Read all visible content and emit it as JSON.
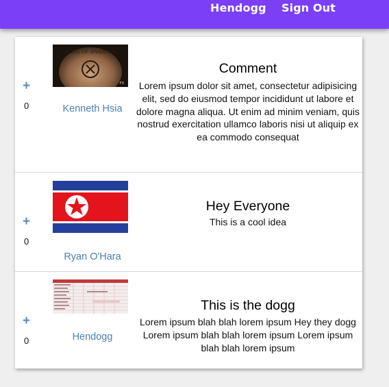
{
  "nav": {
    "user": "Hendogg",
    "sign_out": "Sign Out"
  },
  "posts": [
    {
      "votes": "0",
      "plus": "+",
      "author": "Kenneth Hsia",
      "title": "Comment",
      "body": "Lorem ipsum dolor sit amet, consectetur adipisicing elit, sed do eiusmod tempor incididunt ut labore et dolore magna aliqua. Ut enim ad minim veniam, quis nostrud exercitation ullamco laboris nisi ut aliquip ex ea commodo consequat",
      "thumb_text": "SONS OF ANARCHY",
      "thumb_mark": "FX"
    },
    {
      "votes": "0",
      "plus": "+",
      "author": "Ryan O'Hara",
      "title": "Hey Everyone",
      "body": "This is a cool idea"
    },
    {
      "votes": "0",
      "plus": "+",
      "author": "Hendogg",
      "title": "This is the dogg",
      "body": "Lorem ipsum blah blah lorem ipsum Hey they dogg Lorem ipsum blah blah lorem ipsum Lorem ipsum blah blah lorem ipsum"
    }
  ]
}
